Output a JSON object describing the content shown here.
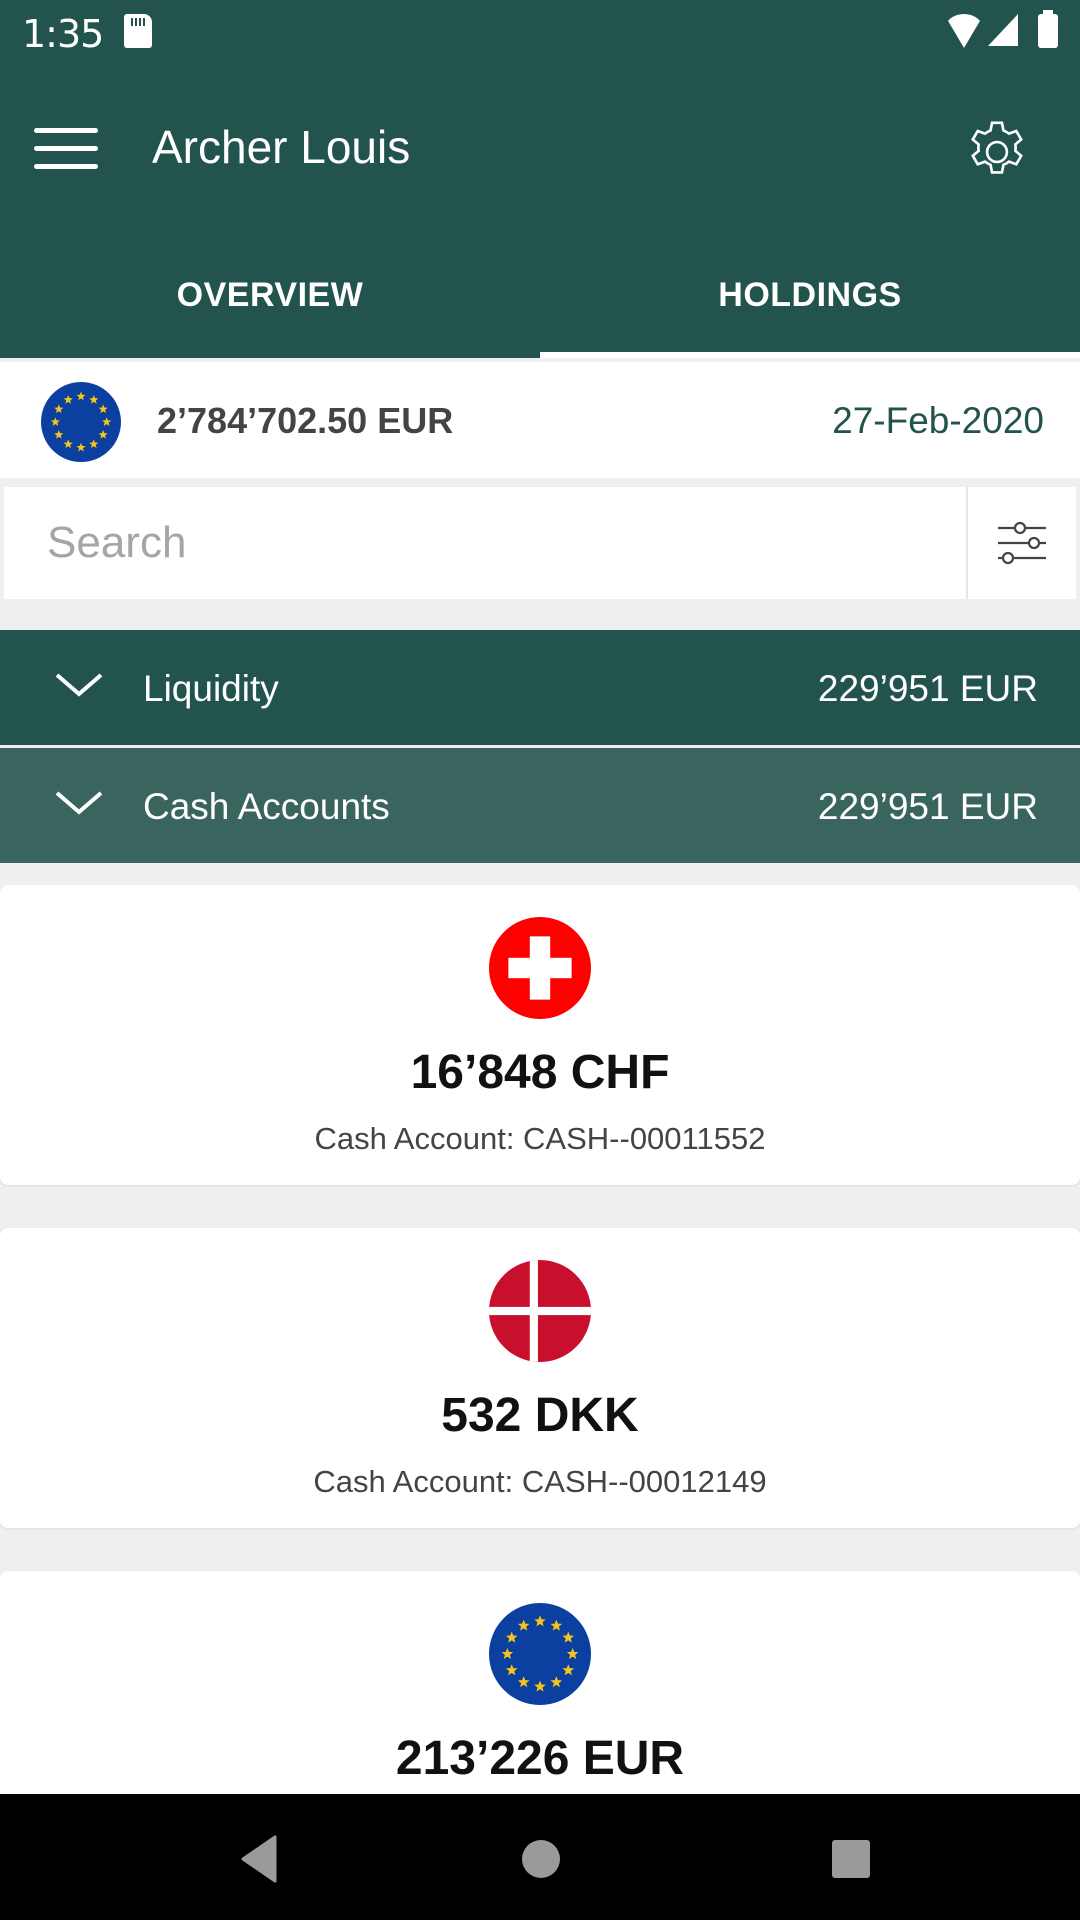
{
  "status_bar": {
    "time": "1:35",
    "icons": [
      "sd-card-icon",
      "wifi-icon",
      "cell-signal-icon",
      "battery-icon"
    ]
  },
  "app_bar": {
    "title": "Archer Louis",
    "menu_icon": "hamburger-menu-icon",
    "settings_icon": "gear-icon"
  },
  "tabs": [
    {
      "label": "OVERVIEW",
      "active": false
    },
    {
      "label": "HOLDINGS",
      "active": true
    }
  ],
  "summary": {
    "flag": "eu-flag-icon",
    "total": "2’784’702.50 EUR",
    "date": "27-Feb-2020"
  },
  "search": {
    "placeholder": "Search",
    "value": "",
    "filter_icon": "sliders-icon"
  },
  "groups": [
    {
      "label": "Liquidity",
      "value": "229’951 EUR",
      "icon": "chevron-down-icon"
    },
    {
      "label": "Cash Accounts",
      "value": "229’951 EUR",
      "icon": "chevron-down-icon"
    }
  ],
  "accounts": [
    {
      "flag": "swiss-flag-icon",
      "amount": "16’848 CHF",
      "account": "Cash Account: CASH--00011552"
    },
    {
      "flag": "danish-flag-icon",
      "amount": "532 DKK",
      "account": "Cash Account: CASH--00012149"
    },
    {
      "flag": "eu-flag-icon",
      "amount": "213’226 EUR",
      "account": ""
    }
  ],
  "colors": {
    "primary": "#22534d",
    "secondary": "#3a655f",
    "background": "#efeff2"
  },
  "nav_bar": {
    "buttons": [
      "back-icon",
      "home-icon",
      "recents-icon"
    ]
  }
}
